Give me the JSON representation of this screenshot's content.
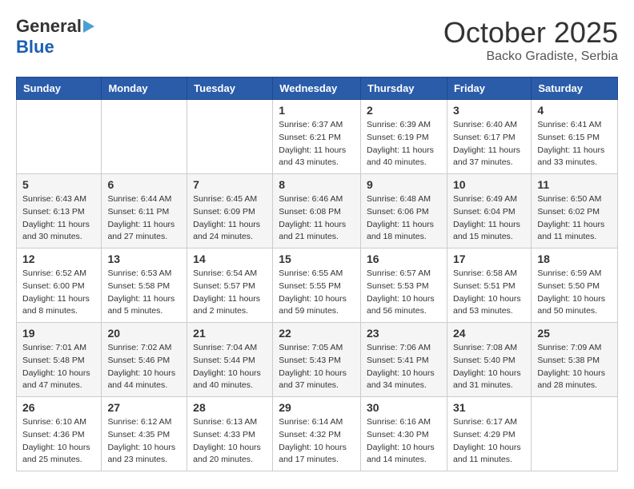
{
  "header": {
    "logo_general": "General",
    "logo_blue": "Blue",
    "month": "October 2025",
    "location": "Backo Gradiste, Serbia"
  },
  "days_of_week": [
    "Sunday",
    "Monday",
    "Tuesday",
    "Wednesday",
    "Thursday",
    "Friday",
    "Saturday"
  ],
  "weeks": [
    [
      {
        "day": "",
        "info": ""
      },
      {
        "day": "",
        "info": ""
      },
      {
        "day": "",
        "info": ""
      },
      {
        "day": "1",
        "info": "Sunrise: 6:37 AM\nSunset: 6:21 PM\nDaylight: 11 hours\nand 43 minutes."
      },
      {
        "day": "2",
        "info": "Sunrise: 6:39 AM\nSunset: 6:19 PM\nDaylight: 11 hours\nand 40 minutes."
      },
      {
        "day": "3",
        "info": "Sunrise: 6:40 AM\nSunset: 6:17 PM\nDaylight: 11 hours\nand 37 minutes."
      },
      {
        "day": "4",
        "info": "Sunrise: 6:41 AM\nSunset: 6:15 PM\nDaylight: 11 hours\nand 33 minutes."
      }
    ],
    [
      {
        "day": "5",
        "info": "Sunrise: 6:43 AM\nSunset: 6:13 PM\nDaylight: 11 hours\nand 30 minutes."
      },
      {
        "day": "6",
        "info": "Sunrise: 6:44 AM\nSunset: 6:11 PM\nDaylight: 11 hours\nand 27 minutes."
      },
      {
        "day": "7",
        "info": "Sunrise: 6:45 AM\nSunset: 6:09 PM\nDaylight: 11 hours\nand 24 minutes."
      },
      {
        "day": "8",
        "info": "Sunrise: 6:46 AM\nSunset: 6:08 PM\nDaylight: 11 hours\nand 21 minutes."
      },
      {
        "day": "9",
        "info": "Sunrise: 6:48 AM\nSunset: 6:06 PM\nDaylight: 11 hours\nand 18 minutes."
      },
      {
        "day": "10",
        "info": "Sunrise: 6:49 AM\nSunset: 6:04 PM\nDaylight: 11 hours\nand 15 minutes."
      },
      {
        "day": "11",
        "info": "Sunrise: 6:50 AM\nSunset: 6:02 PM\nDaylight: 11 hours\nand 11 minutes."
      }
    ],
    [
      {
        "day": "12",
        "info": "Sunrise: 6:52 AM\nSunset: 6:00 PM\nDaylight: 11 hours\nand 8 minutes."
      },
      {
        "day": "13",
        "info": "Sunrise: 6:53 AM\nSunset: 5:58 PM\nDaylight: 11 hours\nand 5 minutes."
      },
      {
        "day": "14",
        "info": "Sunrise: 6:54 AM\nSunset: 5:57 PM\nDaylight: 11 hours\nand 2 minutes."
      },
      {
        "day": "15",
        "info": "Sunrise: 6:55 AM\nSunset: 5:55 PM\nDaylight: 10 hours\nand 59 minutes."
      },
      {
        "day": "16",
        "info": "Sunrise: 6:57 AM\nSunset: 5:53 PM\nDaylight: 10 hours\nand 56 minutes."
      },
      {
        "day": "17",
        "info": "Sunrise: 6:58 AM\nSunset: 5:51 PM\nDaylight: 10 hours\nand 53 minutes."
      },
      {
        "day": "18",
        "info": "Sunrise: 6:59 AM\nSunset: 5:50 PM\nDaylight: 10 hours\nand 50 minutes."
      }
    ],
    [
      {
        "day": "19",
        "info": "Sunrise: 7:01 AM\nSunset: 5:48 PM\nDaylight: 10 hours\nand 47 minutes."
      },
      {
        "day": "20",
        "info": "Sunrise: 7:02 AM\nSunset: 5:46 PM\nDaylight: 10 hours\nand 44 minutes."
      },
      {
        "day": "21",
        "info": "Sunrise: 7:04 AM\nSunset: 5:44 PM\nDaylight: 10 hours\nand 40 minutes."
      },
      {
        "day": "22",
        "info": "Sunrise: 7:05 AM\nSunset: 5:43 PM\nDaylight: 10 hours\nand 37 minutes."
      },
      {
        "day": "23",
        "info": "Sunrise: 7:06 AM\nSunset: 5:41 PM\nDaylight: 10 hours\nand 34 minutes."
      },
      {
        "day": "24",
        "info": "Sunrise: 7:08 AM\nSunset: 5:40 PM\nDaylight: 10 hours\nand 31 minutes."
      },
      {
        "day": "25",
        "info": "Sunrise: 7:09 AM\nSunset: 5:38 PM\nDaylight: 10 hours\nand 28 minutes."
      }
    ],
    [
      {
        "day": "26",
        "info": "Sunrise: 6:10 AM\nSunset: 4:36 PM\nDaylight: 10 hours\nand 25 minutes."
      },
      {
        "day": "27",
        "info": "Sunrise: 6:12 AM\nSunset: 4:35 PM\nDaylight: 10 hours\nand 23 minutes."
      },
      {
        "day": "28",
        "info": "Sunrise: 6:13 AM\nSunset: 4:33 PM\nDaylight: 10 hours\nand 20 minutes."
      },
      {
        "day": "29",
        "info": "Sunrise: 6:14 AM\nSunset: 4:32 PM\nDaylight: 10 hours\nand 17 minutes."
      },
      {
        "day": "30",
        "info": "Sunrise: 6:16 AM\nSunset: 4:30 PM\nDaylight: 10 hours\nand 14 minutes."
      },
      {
        "day": "31",
        "info": "Sunrise: 6:17 AM\nSunset: 4:29 PM\nDaylight: 10 hours\nand 11 minutes."
      },
      {
        "day": "",
        "info": ""
      }
    ]
  ]
}
